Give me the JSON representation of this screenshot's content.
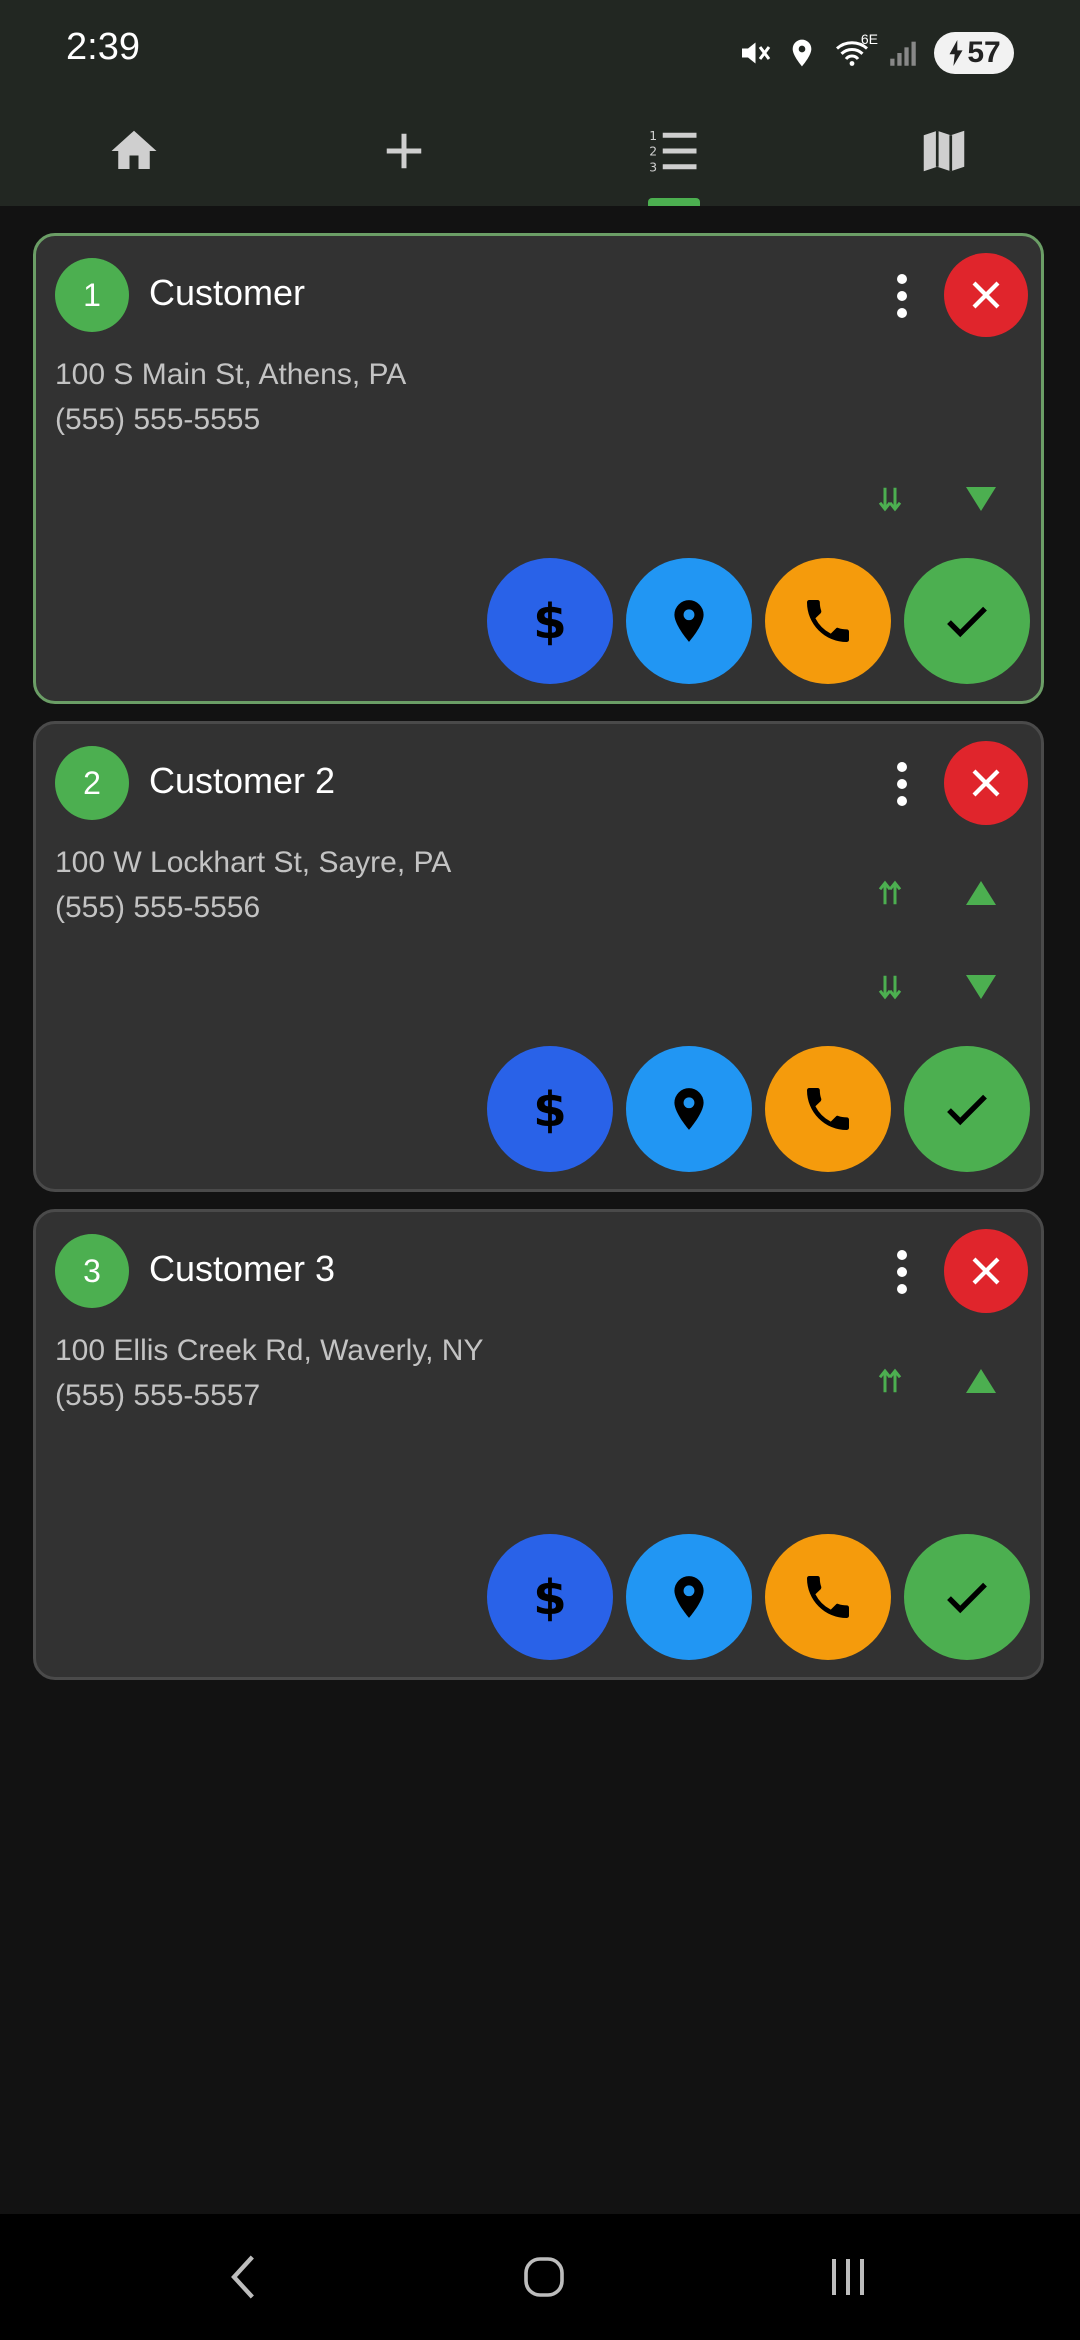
{
  "status_bar": {
    "time": "2:39",
    "network_label": "6E",
    "battery": "57",
    "icons": [
      "mute-icon",
      "location-icon",
      "wifi-icon",
      "signal-icon",
      "battery-charging-icon"
    ]
  },
  "nav": {
    "items": [
      {
        "name": "home",
        "icon": "home-icon"
      },
      {
        "name": "add",
        "icon": "plus-icon"
      },
      {
        "name": "list",
        "icon": "ordered-list-icon",
        "active": true
      },
      {
        "name": "map",
        "icon": "map-icon"
      }
    ],
    "accent": "#4caf50"
  },
  "stops": [
    {
      "number": "1",
      "name": "Customer",
      "address": "100 S Main St, Athens, PA",
      "phone": "(555) 555-5555",
      "active": true
    },
    {
      "number": "2",
      "name": "Customer 2",
      "address": "100 W Lockhart St, Sayre, PA",
      "phone": "(555) 555-5556",
      "active": false
    },
    {
      "number": "3",
      "name": "Customer 3",
      "address": "100 Ellis Creek Rd, Waverly, NY",
      "phone": "(555) 555-5557",
      "active": false
    }
  ],
  "colors": {
    "card_bg": "#323232",
    "active_border": "#6b9e66",
    "delete": "#e0252c",
    "payment": "#2962e8",
    "navigate": "#2196f3",
    "call": "#f59b0c",
    "complete": "#4caf50"
  }
}
